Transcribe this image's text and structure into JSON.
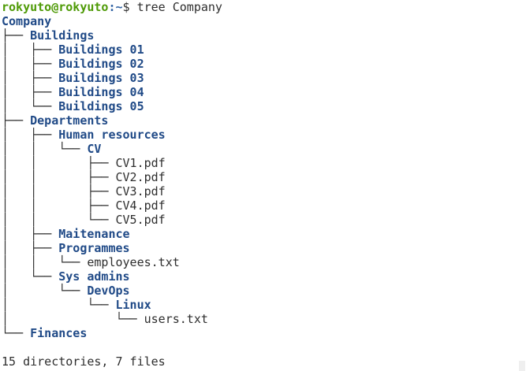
{
  "terminal": {
    "prompt_user_host": "rokyuto@rokyuto",
    "prompt_path": ":~",
    "prompt_symbol": "$ ",
    "command": "tree Company",
    "summary": "15 directories, 7 files"
  },
  "tree": {
    "root": "Company",
    "lines": [
      {
        "prefix": "├── ",
        "name": "Buildings",
        "kind": "dir"
      },
      {
        "prefix": "│   ├── ",
        "name": "Buildings 01",
        "kind": "dir"
      },
      {
        "prefix": "│   ├── ",
        "name": "Buildings 02",
        "kind": "dir"
      },
      {
        "prefix": "│   ├── ",
        "name": "Buildings 03",
        "kind": "dir"
      },
      {
        "prefix": "│   ├── ",
        "name": "Buildings 04",
        "kind": "dir"
      },
      {
        "prefix": "│   └── ",
        "name": "Buildings 05",
        "kind": "dir"
      },
      {
        "prefix": "├── ",
        "name": "Departments",
        "kind": "dir"
      },
      {
        "prefix": "│   ├── ",
        "name": "Human resources",
        "kind": "dir"
      },
      {
        "prefix": "│   │   └── ",
        "name": "CV",
        "kind": "dir"
      },
      {
        "prefix": "│   │       ├── ",
        "name": "CV1.pdf",
        "kind": "file"
      },
      {
        "prefix": "│   │       ├── ",
        "name": "CV2.pdf",
        "kind": "file"
      },
      {
        "prefix": "│   │       ├── ",
        "name": "CV3.pdf",
        "kind": "file"
      },
      {
        "prefix": "│   │       ├── ",
        "name": "CV4.pdf",
        "kind": "file"
      },
      {
        "prefix": "│   │       └── ",
        "name": "CV5.pdf",
        "kind": "file"
      },
      {
        "prefix": "│   ├── ",
        "name": "Maitenance",
        "kind": "dir"
      },
      {
        "prefix": "│   ├── ",
        "name": "Programmes",
        "kind": "dir"
      },
      {
        "prefix": "│   │   └── ",
        "name": "employees.txt",
        "kind": "file"
      },
      {
        "prefix": "│   └── ",
        "name": "Sys admins",
        "kind": "dir"
      },
      {
        "prefix": "│       └── ",
        "name": "DevOps",
        "kind": "dir"
      },
      {
        "prefix": "│           └── ",
        "name": "Linux",
        "kind": "dir"
      },
      {
        "prefix": "│               └── ",
        "name": "users.txt",
        "kind": "file"
      },
      {
        "prefix": "└── ",
        "name": "Finances",
        "kind": "dir"
      }
    ]
  }
}
